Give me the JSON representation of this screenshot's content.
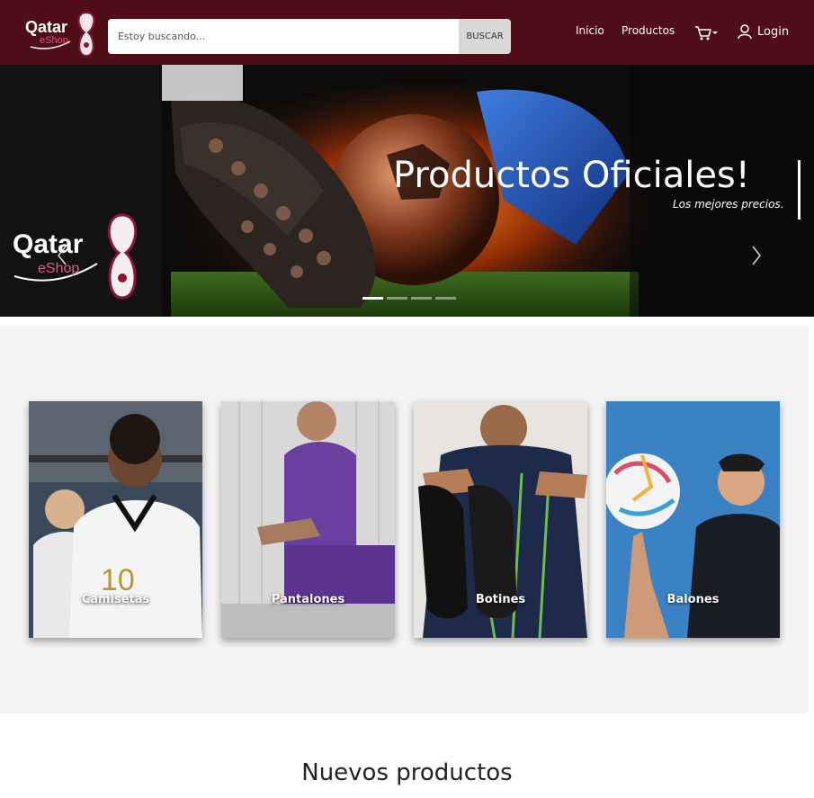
{
  "header": {
    "logo_text": "Qatar",
    "logo_sub": "eShop",
    "search_placeholder": "Estoy buscando...",
    "search_button": "BUSCAR",
    "nav_inicio": "Inicio",
    "nav_productos": "Productos",
    "login_label": "Login",
    "colors": {
      "background": "#4f0d17"
    }
  },
  "hero": {
    "title": "Productos Oficiales!",
    "subtitle": "Los mejores precios.",
    "logo_text": "Qatar",
    "logo_sub": "eShop",
    "slide_count": 4,
    "active_slide": 1
  },
  "categories": [
    {
      "label": "Camisetas"
    },
    {
      "label": "Pantalones"
    },
    {
      "label": "Botines"
    },
    {
      "label": "Balones"
    }
  ],
  "new_products": {
    "title": "Nuevos productos"
  }
}
